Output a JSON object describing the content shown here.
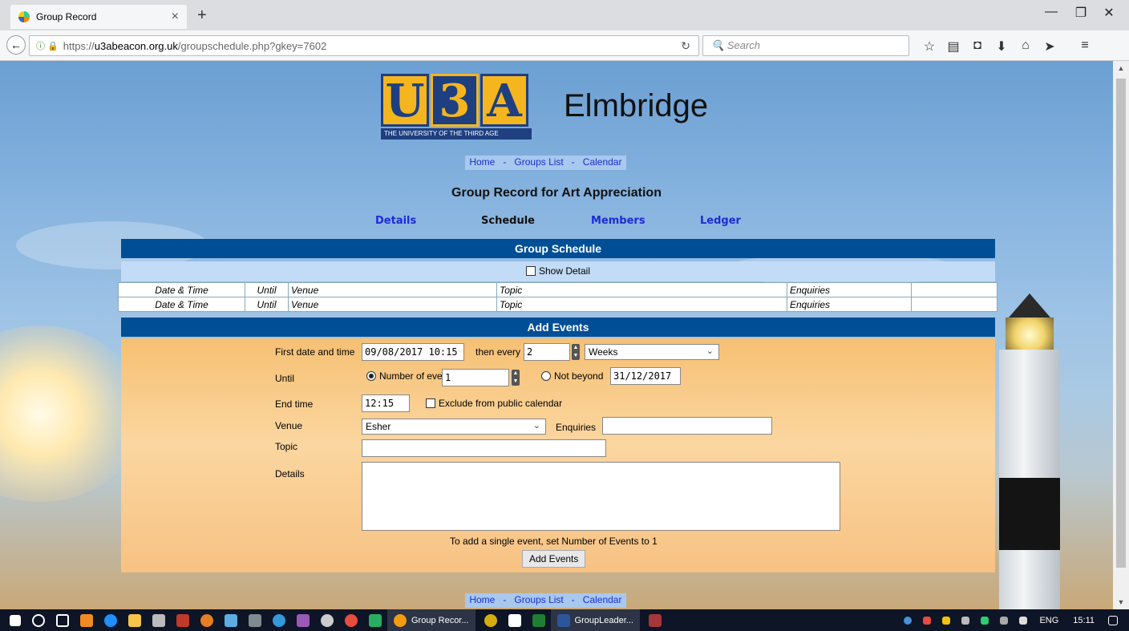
{
  "browser": {
    "tab_title": "Group Record",
    "url_prefix": "https://",
    "url_domain": "u3abeacon.org.uk",
    "url_path": "/groupschedule.php?gkey=7602",
    "search_placeholder": "Search"
  },
  "site": {
    "logo_letters": [
      "U",
      "3",
      "A"
    ],
    "logo_subtitle": "THE UNIVERSITY OF THE THIRD AGE",
    "brand": "Elmbridge"
  },
  "nav": {
    "home": "Home",
    "sep": "-",
    "groups": "Groups List",
    "calendar": "Calendar"
  },
  "page_title": "Group Record for Art Appreciation",
  "subnav": {
    "details": "Details",
    "schedule": "Schedule",
    "members": "Members",
    "ledger": "Ledger"
  },
  "schedule": {
    "heading": "Group Schedule",
    "show_detail": "Show Detail",
    "columns": [
      "Date & Time",
      "Until",
      "Venue",
      "Topic",
      "Enquiries",
      ""
    ],
    "rows": [
      [
        "Date & Time",
        "Until",
        "Venue",
        "Topic",
        "Enquiries",
        ""
      ],
      [
        "Date & Time",
        "Until",
        "Venue",
        "Topic",
        "Enquiries",
        ""
      ]
    ]
  },
  "add_events": {
    "heading": "Add Events",
    "first_label": "First date and time",
    "first_value": "09/08/2017 10:15",
    "then_every_label": "then every",
    "every_value": "2",
    "period_value": "Weeks",
    "until_label": "Until",
    "num_events_label": "Number of events",
    "num_events_value": "1",
    "not_beyond_label": "Not beyond",
    "not_beyond_value": "31/12/2017",
    "end_time_label": "End time",
    "end_time_value": "12:15",
    "exclude_label": "Exclude from public calendar",
    "venue_label": "Venue",
    "venue_value": "Esher",
    "enquiries_label": "Enquiries",
    "enquiries_value": "",
    "topic_label": "Topic",
    "topic_value": "",
    "details_label": "Details",
    "details_value": "",
    "hint": "To add a single event, set Number of Events to 1",
    "submit": "Add Events"
  },
  "taskbar": {
    "apps": [
      "Group Recor...",
      "GroupLeader..."
    ],
    "lang": "ENG",
    "time": "15:11"
  }
}
